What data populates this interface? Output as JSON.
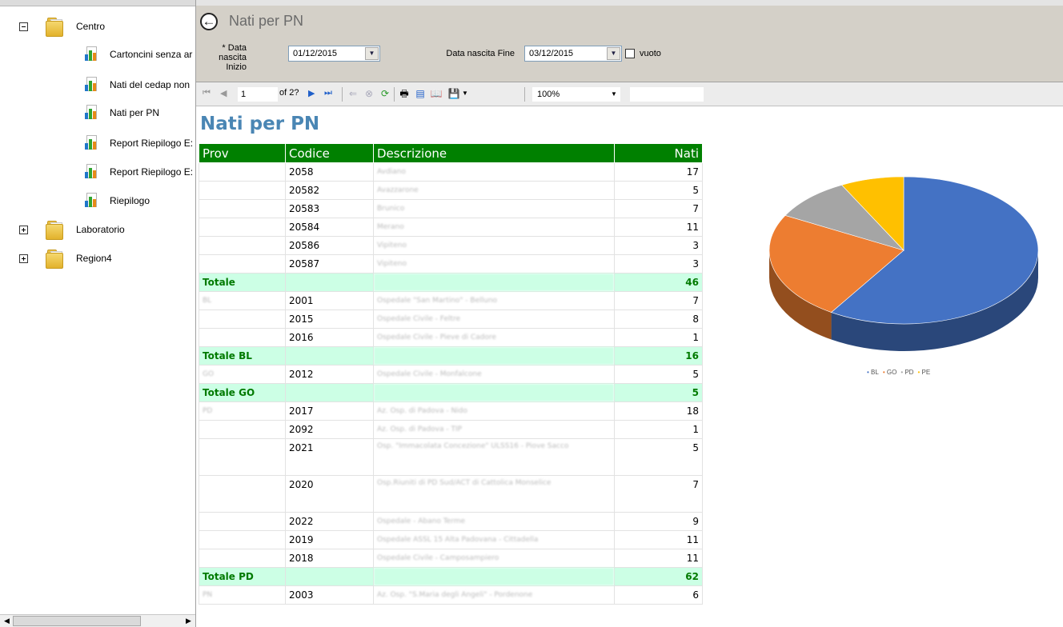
{
  "tree": {
    "folders": [
      {
        "label": "Centro",
        "state": "expanded"
      },
      {
        "label": "Laboratorio",
        "state": "collapsed"
      },
      {
        "label": "Region4",
        "state": "collapsed"
      }
    ],
    "reports": [
      {
        "label": "Cartoncini senza ar"
      },
      {
        "label": "Nati del cedap non"
      },
      {
        "label": "Nati per PN"
      },
      {
        "label": "Report Riepilogo E:"
      },
      {
        "label": "Report Riepilogo E:"
      },
      {
        "label": "Riepilogo"
      }
    ],
    "scroll_left": "◀",
    "scroll_right": "▶"
  },
  "header": {
    "title": "Nati per PN",
    "back_icon": "←",
    "param_start_label_1": "* Data nascita",
    "param_start_label_2": "Inizio",
    "param_start_value": "01/12/2015",
    "param_end_label": "Data nascita Fine",
    "param_end_value": "03/12/2015",
    "checkbox_label": "vuoto",
    "dropdown_icon": "▼"
  },
  "toolbar": {
    "first": "⏮",
    "prev": "◀",
    "page": "1",
    "of": "of 2?",
    "next": "▶",
    "last": "⏭",
    "back": "⇐",
    "stop": "⊗",
    "refresh": "⟳",
    "print": "🖶",
    "layout": "▤",
    "pagesetup": "📖",
    "export": "💾",
    "zoom": "100%"
  },
  "report": {
    "title": "Nati per PN",
    "columns": [
      "Prov",
      "Codice",
      "Descrizione",
      "Nati"
    ],
    "rows": [
      {
        "type": "data",
        "prov": "",
        "codice": "2058",
        "descr": "Avdiano",
        "nati": "17"
      },
      {
        "type": "data",
        "prov": "",
        "codice": "20582",
        "descr": "Avazzarone",
        "nati": "5"
      },
      {
        "type": "data",
        "prov": "",
        "codice": "20583",
        "descr": "Brunico",
        "nati": "7"
      },
      {
        "type": "data",
        "prov": "",
        "codice": "20584",
        "descr": "Merano",
        "nati": "11"
      },
      {
        "type": "data",
        "prov": "",
        "codice": "20586",
        "descr": "Vipiteno",
        "nati": "3"
      },
      {
        "type": "data",
        "prov": "",
        "codice": "20587",
        "descr": "Vipiteno",
        "nati": "3"
      },
      {
        "type": "total",
        "prov": "Totale",
        "codice": "",
        "descr": "",
        "nati": "46"
      },
      {
        "type": "data",
        "prov": "BL",
        "codice": "2001",
        "descr": "Ospedale \"San Martino\" - Belluno",
        "nati": "7"
      },
      {
        "type": "data",
        "prov": "",
        "codice": "2015",
        "descr": "Ospedale Civile - Feltre",
        "nati": "8"
      },
      {
        "type": "data",
        "prov": "",
        "codice": "2016",
        "descr": "Ospedale Civile - Pieve di Cadore",
        "nati": "1"
      },
      {
        "type": "total",
        "prov": "Totale BL",
        "codice": "",
        "descr": "",
        "nati": "16"
      },
      {
        "type": "data",
        "prov": "GO",
        "codice": "2012",
        "descr": "Ospedale Civile - Monfalcone",
        "nati": "5"
      },
      {
        "type": "total",
        "prov": "Totale GO",
        "codice": "",
        "descr": "",
        "nati": "5"
      },
      {
        "type": "data",
        "prov": "PD",
        "codice": "2017",
        "descr": "Az. Osp. di Padova - Nido",
        "nati": "18"
      },
      {
        "type": "data",
        "prov": "",
        "codice": "2092",
        "descr": "Az. Osp. di Padova - TIP",
        "nati": "1"
      },
      {
        "type": "tall",
        "prov": "",
        "codice": "2021",
        "descr": "Osp. \"Immacolata Concezione\" ULSS16 - Piove Sacco",
        "nati": "5"
      },
      {
        "type": "tall",
        "prov": "",
        "codice": "2020",
        "descr": "Osp.Riuniti di PD Sud/ACT di Cattolica Monselice",
        "nati": "7"
      },
      {
        "type": "data",
        "prov": "",
        "codice": "2022",
        "descr": "Ospedale - Abano Terme",
        "nati": "9"
      },
      {
        "type": "data",
        "prov": "",
        "codice": "2019",
        "descr": "Ospedale ASSL 15 Alta Padovana - Cittadella",
        "nati": "11"
      },
      {
        "type": "data",
        "prov": "",
        "codice": "2018",
        "descr": "Ospedale Civile - Camposampiero",
        "nati": "11"
      },
      {
        "type": "total",
        "prov": "Totale PD",
        "codice": "",
        "descr": "",
        "nati": "62"
      },
      {
        "type": "data",
        "prov": "PN",
        "codice": "2003",
        "descr": "Az. Osp. \"S.Maria degli Angeli\" - Pordenone",
        "nati": "6"
      }
    ]
  },
  "chart_data": {
    "type": "pie",
    "title": "",
    "categories": [
      "BL",
      "GO",
      "PD",
      "PE"
    ],
    "values": [
      62,
      25,
      10,
      8
    ],
    "colors": [
      "#4472c4",
      "#ed7d31",
      "#a5a5a5",
      "#ffc000"
    ],
    "legend": "bottom",
    "legend_labels": [
      "BL",
      "GO",
      "PD",
      "PE"
    ]
  }
}
